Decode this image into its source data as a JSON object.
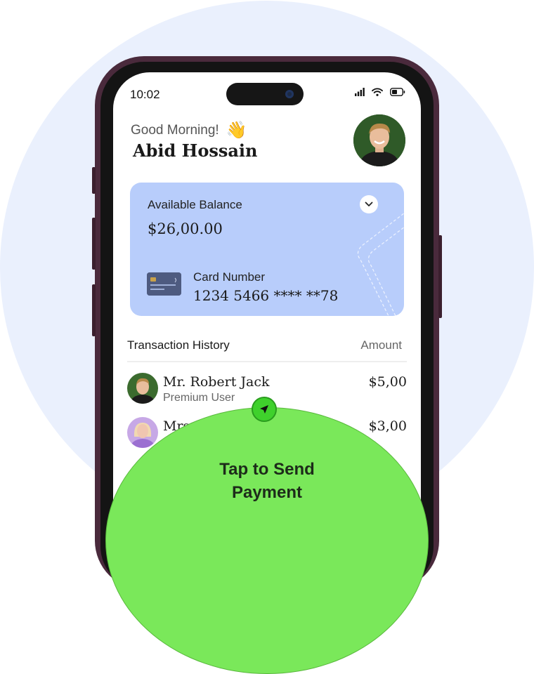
{
  "status_bar": {
    "time": "10:02"
  },
  "header": {
    "greeting": "Good Morning!",
    "greeting_emoji": "👋",
    "user_name": "Abid Hossain"
  },
  "balance_card": {
    "label": "Available Balance",
    "amount": "$26,00.00",
    "card_number_label": "Card Number",
    "card_number": "1234 5466 **** **78"
  },
  "transactions": {
    "title": "Transaction History",
    "amount_header": "Amount",
    "items": [
      {
        "name": "Mr. Robert Jack",
        "subtitle": "Premium User",
        "amount": "$5,00"
      },
      {
        "name": "Mrs",
        "subtitle": "",
        "amount": "$3,00"
      }
    ]
  },
  "send_action": {
    "label_line1": "Tap to Send",
    "label_line2": "Payment"
  },
  "colors": {
    "background_circle": "#eaf0fd",
    "card": "#b8cdfb",
    "send_area": "#7ae85a",
    "send_icon": "#3fd12c",
    "phone_frame": "#4a2a3c"
  }
}
